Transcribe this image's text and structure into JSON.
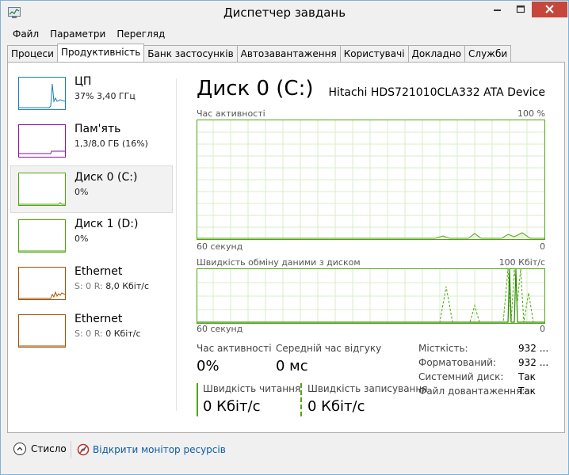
{
  "window": {
    "title": "Диспетчер завдань"
  },
  "menu": [
    "Файл",
    "Параметри",
    "Перегляд"
  ],
  "tabs": [
    {
      "label": "Процеси",
      "active": false
    },
    {
      "label": "Продуктивність",
      "active": true
    },
    {
      "label": "Банк застосунків",
      "active": false
    },
    {
      "label": "Автозавантаження",
      "active": false
    },
    {
      "label": "Користувачі",
      "active": false
    },
    {
      "label": "Докладно",
      "active": false
    },
    {
      "label": "Служби",
      "active": false
    }
  ],
  "sidebar": [
    {
      "title": "ЦП",
      "sub": "37%  3,40 ГГц",
      "color": "#1b7bbd"
    },
    {
      "title": "Пам'ять",
      "sub": "1,3/8,0 ГБ (16%)",
      "color": "#8b12ae"
    },
    {
      "title": "Диск 0 (C:)",
      "sub": "0%",
      "color": "#4da60c",
      "selected": true
    },
    {
      "title": "Диск 1 (D:)",
      "sub": "0%",
      "color": "#4da60c"
    },
    {
      "title": "Ethernet",
      "sub_s": "S: 0",
      "sub_r_label": "R:",
      "sub_r": "8,0 Кбіт/с",
      "color": "#a74f01"
    },
    {
      "title": "Ethernet",
      "sub_s": "S: 0",
      "sub_r_label": "R:",
      "sub_r": "0 Кбіт/с",
      "color": "#a74f01"
    }
  ],
  "main": {
    "title": "Диск 0 (C:)",
    "device": "Hitachi HDS721010CLA332 ATA Device",
    "graph1": {
      "label": "Час активності",
      "max": "100 %",
      "time": "60 секунд",
      "min": "0"
    },
    "graph2": {
      "label": "Швидкість обміну даними з диском",
      "max": "100 Кбіт/с",
      "time": "60 секунд",
      "min": "0"
    },
    "stats": {
      "active_label": "Час активності",
      "active_value": "0%",
      "response_label": "Середній час відгуку",
      "response_value": "0 мс",
      "read_label": "Швидкість читання",
      "read_value": "0 Кбіт/с",
      "write_label": "Швидкість записування",
      "write_value": "0 Кбіт/с"
    },
    "props": [
      {
        "key": "Місткість:",
        "value": "932 ..."
      },
      {
        "key": "Форматований:",
        "value": "932 ..."
      },
      {
        "key": "Системний диск:",
        "value": "Так"
      },
      {
        "key": "Файл довантаження:",
        "value": "Так"
      }
    ]
  },
  "footer": {
    "fewer": "Стисло",
    "monitor": "Відкрити монітор ресурсів"
  },
  "colors": {
    "disk_green": "#4da60c",
    "link_blue": "#0b5ba8",
    "close_red": "#c7463b"
  }
}
